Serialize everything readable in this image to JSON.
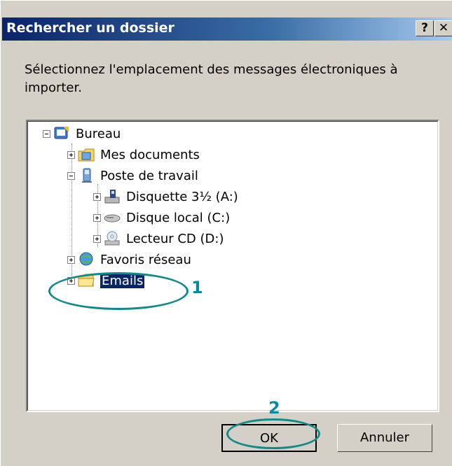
{
  "dialog": {
    "title": "Rechercher un dossier",
    "help_button": "?",
    "close_button": "✕",
    "description": "Sélectionnez l'emplacement des messages électroniques à importer."
  },
  "tree": {
    "items": [
      {
        "label": "Bureau",
        "icon": "desktop-icon",
        "expander": "minus"
      },
      {
        "label": "Mes documents",
        "icon": "documents-folder-icon",
        "expander": "plus"
      },
      {
        "label": "Poste de travail",
        "icon": "computer-icon",
        "expander": "minus"
      },
      {
        "label": "Disquette 3½ (A:)",
        "icon": "floppy-drive-icon",
        "expander": "plus"
      },
      {
        "label": "Disque local (C:)",
        "icon": "hard-drive-icon",
        "expander": "plus"
      },
      {
        "label": "Lecteur CD (D:)",
        "icon": "cd-drive-icon",
        "expander": "plus"
      },
      {
        "label": "Favoris réseau",
        "icon": "network-icon",
        "expander": "plus"
      },
      {
        "label": "Emails",
        "icon": "folder-icon",
        "expander": "plus",
        "selected": true
      }
    ]
  },
  "annotations": {
    "step1": "1",
    "step2": "2",
    "color": "#138a8a"
  },
  "buttons": {
    "ok": "OK",
    "cancel": "Annuler"
  }
}
